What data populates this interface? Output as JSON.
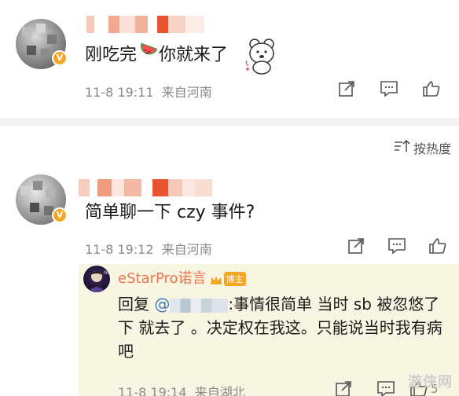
{
  "comments": [
    {
      "text_before": "刚吃完",
      "emoji": "watermelon",
      "text_after": "你就来了",
      "timestamp": "11-8 19:11",
      "location": "来自河南",
      "sticker": "bear-sticker"
    },
    {
      "text": "简单聊一下 czy 事件?",
      "timestamp": "11-8 19:12",
      "location": "来自河南"
    }
  ],
  "sort_label": "按热度",
  "reply": {
    "username": "eStarPro诺言",
    "owner_badge": "博主",
    "prefix": "回复",
    "mention": "@",
    "body": ":事情很简单 当时 sb 被忽悠了下 就去了 。决定权在我这。只能说当时我有病吧",
    "timestamp": "11-8 19:14",
    "location": "来自湖北",
    "like_count": "5"
  },
  "icons": [
    "share-icon",
    "comment-icon",
    "like-icon",
    "sort-icon"
  ],
  "colors": {
    "accent_orange": "#eb7350",
    "vip": "#f5a623",
    "reply_bg": "#f8f6e3",
    "meta_gray": "#8a8a8a"
  },
  "watermark": "游侠网"
}
